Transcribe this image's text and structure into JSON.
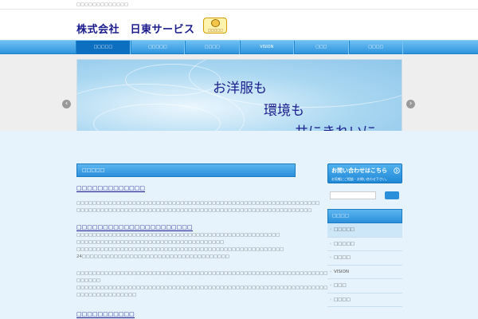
{
  "topbar": {
    "tagline": "□□□□□□□□□□□□□"
  },
  "header": {
    "logo_text": "株式会社　日東サービス",
    "badge_caption": "□□□□□"
  },
  "nav": {
    "items": [
      "□□□□□",
      "□□□□□",
      "□□□□",
      "VISION",
      "□□□",
      "□□□□"
    ],
    "active_index": 0
  },
  "slider": {
    "line1": "お洋服も",
    "line2": "環境も",
    "line3": "共にきれいに",
    "prev_glyph": "‹",
    "next_glyph": "›"
  },
  "main": {
    "section_title": "□□□□□",
    "heading1": "□□□□□□□□□□□□□",
    "para1": [
      "□□□□□□□□□□□□□□□□□□□□□□□□□□□□□□□□□□□□□□□□□□□□□□□□□□□□□□□□□□□□□",
      "□□□□□□□□□□□□□□□□□□□□□□□□□□□□□□□□□□□□□□□□□□□□□□□□□□□□□□□□□□□"
    ],
    "heading2": "□□□□□□□□□□□□□□□□□□□□□□",
    "para2": [
      "□□□□□□□□□□□□□□□□□□□□□□□□□□□□□□□□□□□□□□□□□□□□□□□□□□□",
      "□□□□□□□□□□□□□□□□□□□□□□□□□□□□□□□□□□□□□",
      "□□□□□□□□□□□□□□□□□□□□□□□□□□□□□□□□□□□□□□□□□□□□□□□□□□□□",
      "24□□□□□□□□□□□□□□□□□□□□□□□□□□□□□□□□□□□□□"
    ],
    "para3": [
      "□□□□□□□□□□□□□□□□□□□□□□□□□□□□□□□□□□□□□□□□□□□□□□□□□□□□□□□□□□□□□□□□□□",
      "□□□□□□",
      "□□□□□□□□□□□□□□□□□□□□□□□□□□□□□□□□□□□□□□□□□□□□□□□□□□□□□□□□□□□□□□□□□□",
      "□□□□□□□□□□□□□□□"
    ],
    "heading3": "□□□□□□□□□□□"
  },
  "sidebar": {
    "contact_title": "お問い合わせはこちら",
    "contact_icon": "arrow-circle-icon",
    "contact_sub": "お気軽にご相談・お問い合わせ下さい。",
    "menu_title": "□□□□",
    "menu_items": [
      "□□□□□",
      "□□□□□",
      "□□□□",
      "VISION",
      "□□□",
      "□□□□"
    ],
    "menu_chevron": "›",
    "selected_index": 0
  },
  "colors": {
    "brand_navy": "#1a1a8c",
    "accent_blue": "#2a8fdb",
    "content_bg": "#e6f3fc"
  }
}
